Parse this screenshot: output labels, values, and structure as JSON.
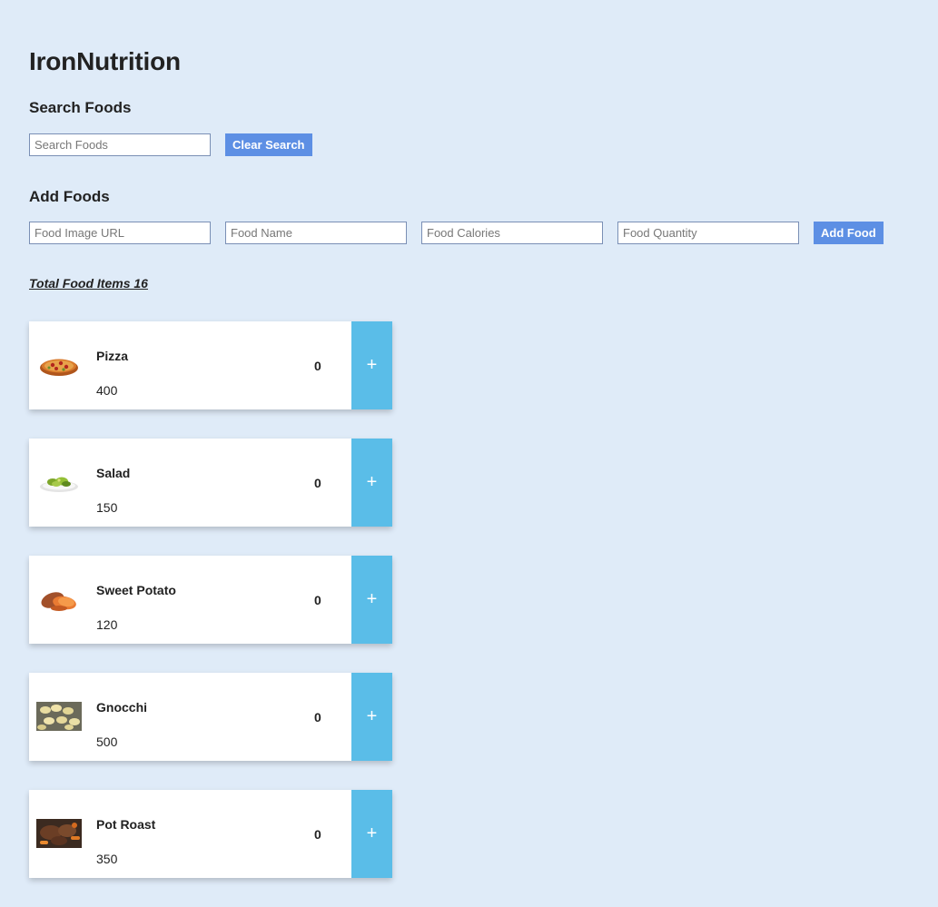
{
  "app": {
    "title": "IronNutrition"
  },
  "search": {
    "heading": "Search Foods",
    "placeholder": "Search Foods",
    "value": "",
    "clear_label": "Clear Search"
  },
  "add": {
    "heading": "Add Foods",
    "image_placeholder": "Food Image URL",
    "name_placeholder": "Food Name",
    "calories_placeholder": "Food Calories",
    "quantity_placeholder": "Food Quantity",
    "submit_label": "Add Food"
  },
  "total": {
    "label": "Total Food Items 16"
  },
  "foods": [
    {
      "name": "Pizza",
      "calories": "400",
      "quantity": "0",
      "icon": "pizza-icon",
      "plus": "+"
    },
    {
      "name": "Salad",
      "calories": "150",
      "quantity": "0",
      "icon": "salad-icon",
      "plus": "+"
    },
    {
      "name": "Sweet Potato",
      "calories": "120",
      "quantity": "0",
      "icon": "sweet-potato-icon",
      "plus": "+"
    },
    {
      "name": "Gnocchi",
      "calories": "500",
      "quantity": "0",
      "icon": "gnocchi-icon",
      "plus": "+"
    },
    {
      "name": "Pot Roast",
      "calories": "350",
      "quantity": "0",
      "icon": "pot-roast-icon",
      "plus": "+"
    }
  ],
  "colors": {
    "background": "#dfebf8",
    "button": "#5d8fe4",
    "plus_button": "#5abde8"
  }
}
